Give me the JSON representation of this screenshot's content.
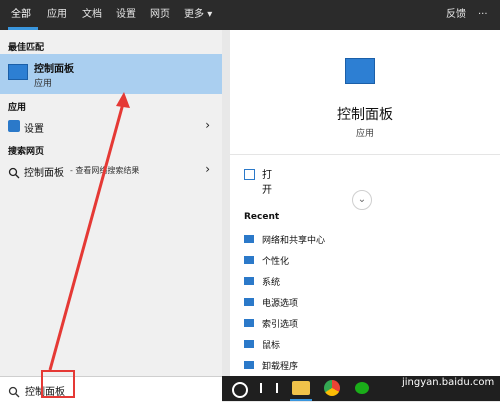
{
  "tabs": [
    {
      "label": "全部",
      "active": true
    },
    {
      "label": "应用",
      "active": false
    },
    {
      "label": "文档",
      "active": false
    },
    {
      "label": "设置",
      "active": false
    },
    {
      "label": "网页",
      "active": false
    },
    {
      "label": "更多",
      "active": false
    }
  ],
  "header": {
    "more_chevron": "▾",
    "feedback": "反馈",
    "ellipsis": "···"
  },
  "left": {
    "best_match_title": "最佳匹配",
    "best_match": {
      "name": "控制面板",
      "subtitle": "应用",
      "icon": "control-panel-icon"
    },
    "apps_title": "应用",
    "app_item": {
      "name": "设置",
      "icon": "gear-icon"
    },
    "web_title": "搜索网页",
    "web_item": {
      "name": "控制面板",
      "suffix": "- 查看网络搜索结果",
      "icon": "search-icon"
    }
  },
  "right": {
    "title": "控制面板",
    "subtitle": "应用",
    "open_label": "打开",
    "recent_title": "Recent",
    "recent": [
      {
        "label": "网络和共享中心"
      },
      {
        "label": "个性化"
      },
      {
        "label": "系统"
      },
      {
        "label": "电源选项"
      },
      {
        "label": "索引选项"
      },
      {
        "label": "鼠标"
      },
      {
        "label": "卸载程序"
      }
    ]
  },
  "search": {
    "query": "控制面板"
  },
  "watermark": "jingyan.baidu.com",
  "colors": {
    "accent": "#3a96dd",
    "selected": "#aacff0",
    "annotation": "#e53935"
  }
}
